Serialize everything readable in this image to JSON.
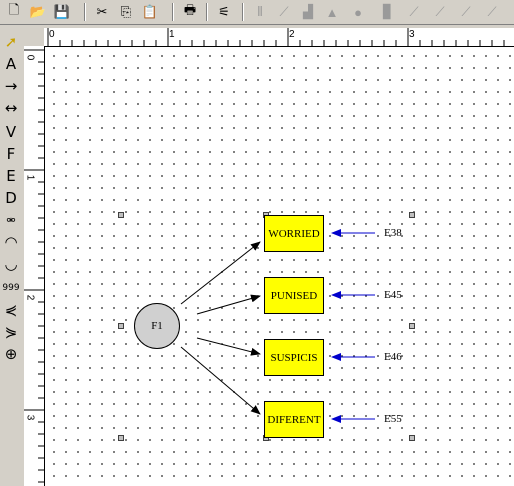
{
  "toolbar": {
    "buttons": [
      "new-file-icon",
      "open-folder-icon",
      "save-icon",
      "cut-icon",
      "copy-icon",
      "paste-icon",
      "print-icon",
      "diagram-icon",
      "chart-1-icon",
      "chart-2-icon",
      "chart-3-icon",
      "chart-4-icon",
      "chart-5-icon",
      "chart-6-icon",
      "chart-7-icon",
      "chart-8-icon",
      "chart-9-icon",
      "chart-10-icon"
    ]
  },
  "left_tools": {
    "items": [
      {
        "icon": "pointer-icon"
      },
      {
        "label": "A"
      },
      {
        "icon": "arrow-right-icon"
      },
      {
        "icon": "double-arrow-icon"
      },
      {
        "label": "V"
      },
      {
        "label": "F"
      },
      {
        "label": "E"
      },
      {
        "label": "D"
      },
      {
        "icon": "link-icon"
      },
      {
        "icon": "curve-up-icon"
      },
      {
        "icon": "curve-down-icon"
      },
      {
        "label": "999"
      },
      {
        "icon": "fan-left-icon"
      },
      {
        "icon": "fan-right-icon"
      },
      {
        "icon": "crosshair-icon"
      }
    ]
  },
  "ruler": {
    "top_labels": [
      "0",
      "1",
      "2",
      "3"
    ],
    "left_labels": [
      "0",
      "1",
      "2",
      "3"
    ]
  },
  "diagram": {
    "factor": "F1",
    "indicators": [
      {
        "label": "WORRIED",
        "error": "E38"
      },
      {
        "label": "PUNISED",
        "error": "E45"
      },
      {
        "label": "SUSPICIS",
        "error": "E46"
      },
      {
        "label": "DIFERENT",
        "error": "E55"
      }
    ],
    "colors": {
      "indicator_fill": "#ffff00",
      "error_arrow": "#0000cc",
      "factor_fill": "#d0d0d0"
    }
  }
}
